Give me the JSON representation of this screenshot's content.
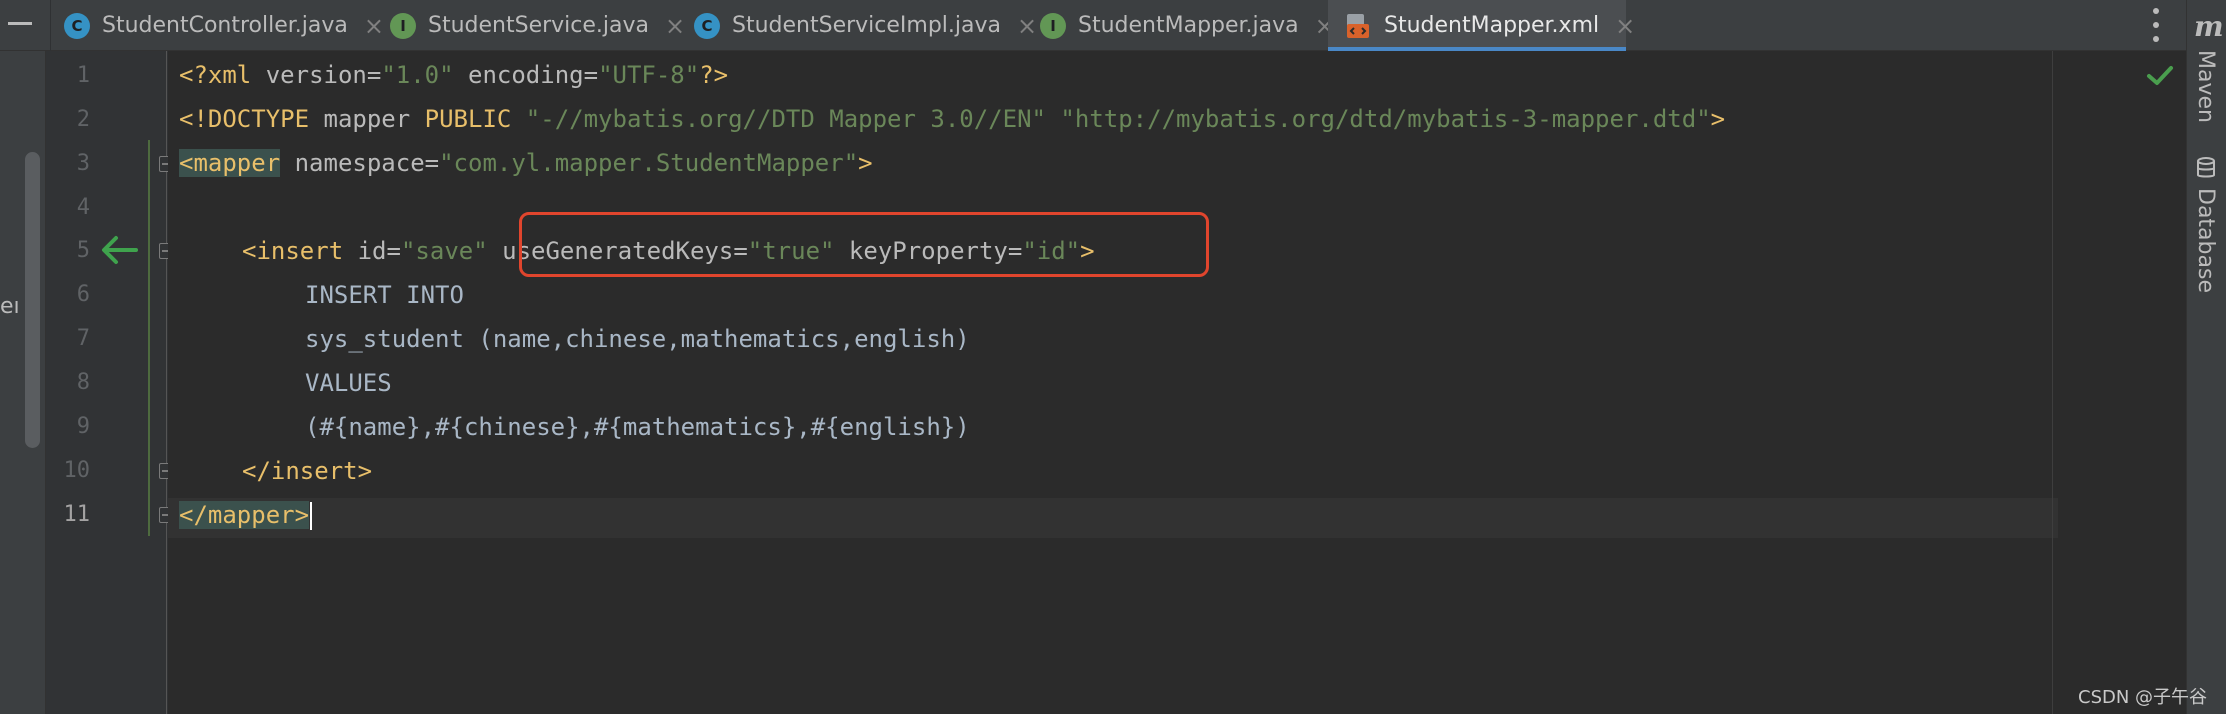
{
  "tabs": [
    {
      "label": "StudentController.java",
      "icon": "C",
      "icon_name": "class-icon"
    },
    {
      "label": "StudentService.java",
      "icon": "I",
      "icon_name": "interface-icon"
    },
    {
      "label": "StudentServiceImpl.java",
      "icon": "C",
      "icon_name": "class-icon"
    },
    {
      "label": "StudentMapper.java",
      "icon": "I",
      "icon_name": "interface-icon"
    },
    {
      "label": "StudentMapper.xml",
      "icon": "",
      "icon_name": "xml-file-icon",
      "active": true
    }
  ],
  "left_strip": {
    "clipped_text": "eı"
  },
  "line_numbers": [
    "1",
    "2",
    "3",
    "4",
    "5",
    "6",
    "7",
    "8",
    "9",
    "10",
    "11"
  ],
  "code": {
    "l1": {
      "open": "<?",
      "tag": "xml",
      "a1": " version",
      "eq1": "=",
      "v1": "\"1.0\"",
      "a2": " encoding",
      "eq2": "=",
      "v2": "\"UTF-8\"",
      "close": "?>"
    },
    "l2": {
      "tag": "<!DOCTYPE",
      "a1": " mapper",
      "kw": " PUBLIC",
      "v1": " \"-//mybatis.org//DTD Mapper 3.0//EN\"",
      "v2": " \"http://mybatis.org/dtd/mybatis-3-mapper.dtd\"",
      "close": ">"
    },
    "l3": {
      "lt": "<",
      "tag": "mapper",
      "a1": " namespace",
      "eq1": "=",
      "v1": "\"com.yl.mapper.StudentMapper\"",
      "close": ">"
    },
    "l5": {
      "tag": "<insert",
      "a1": " id",
      "eq1": "=",
      "v1": "\"save\"",
      "a2": " useGeneratedKeys",
      "eq2": "=",
      "v2": "\"true\"",
      "a3": " keyProperty",
      "eq3": "=",
      "v3": "\"id\"",
      "close": ">"
    },
    "l6": "INSERT INTO",
    "l7": "sys_student (name,chinese,mathematics,english)",
    "l8": "VALUES",
    "l9": "(#{name},#{chinese},#{mathematics},#{english})",
    "l10": "</insert>",
    "l11": {
      "tag": "</mapper",
      "close": ">"
    }
  },
  "right_strip": {
    "maven_glyph": "m",
    "maven_label": "Maven",
    "database_label": "Database"
  },
  "watermark": "CSDN @子午谷",
  "colors": {
    "tag": "#e8bf6a",
    "string": "#6a8759",
    "highlight_box": "#e0452d",
    "active_tab_underline": "#4a88c7"
  }
}
